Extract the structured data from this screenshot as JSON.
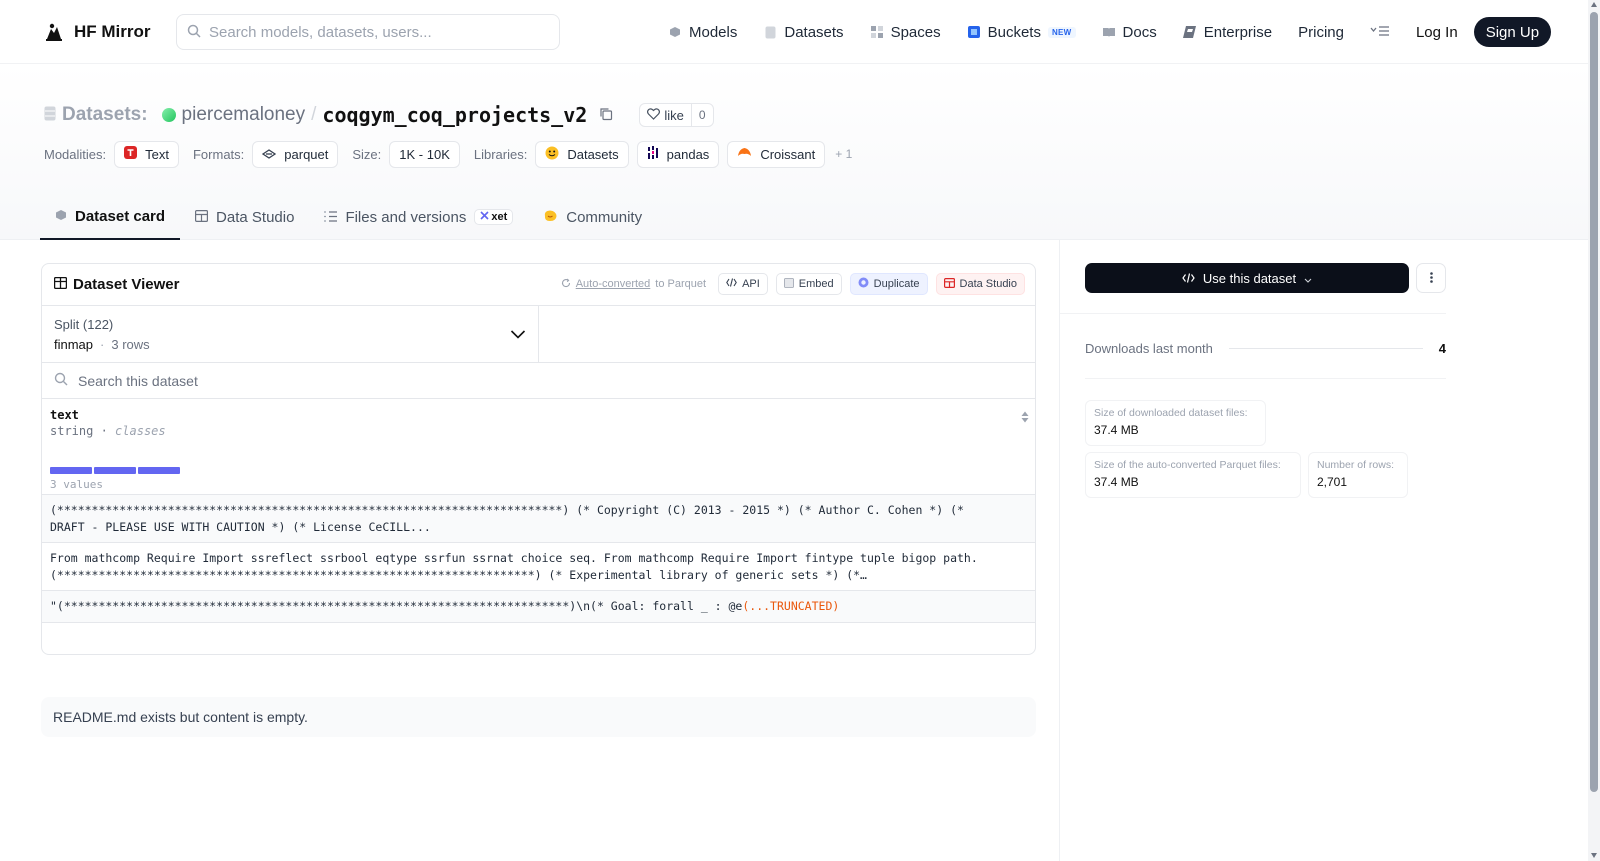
{
  "nav": {
    "brand": "HF Mirror",
    "search_placeholder": "Search models, datasets, users...",
    "links": [
      {
        "label": "Models",
        "icon": "model-cube-icon"
      },
      {
        "label": "Datasets",
        "icon": "database-icon"
      },
      {
        "label": "Spaces",
        "icon": "spaces-grid-icon"
      },
      {
        "label": "Buckets",
        "icon": "bucket-icon",
        "badge": "NEW"
      },
      {
        "label": "Docs",
        "icon": "book-icon"
      },
      {
        "label": "Enterprise",
        "icon": "enterprise-icon"
      },
      {
        "label": "Pricing"
      }
    ],
    "login": "Log In",
    "signup": "Sign Up"
  },
  "header": {
    "prefix": "Datasets:",
    "owner": "piercemaloney",
    "separator": "/",
    "repo": "coqgym_coq_projects_v2",
    "like_label": "like",
    "like_count": "0",
    "meta": {
      "modalities_label": "Modalities:",
      "modality": "Text",
      "formats_label": "Formats:",
      "format": "parquet",
      "size_label": "Size:",
      "size": "1K - 10K",
      "libraries_label": "Libraries:",
      "libraries": [
        "Datasets",
        "pandas",
        "Croissant"
      ],
      "more": "+ 1"
    }
  },
  "tabs": [
    {
      "label": "Dataset card",
      "active": true
    },
    {
      "label": "Data Studio"
    },
    {
      "label": "Files and versions",
      "badge": "xet"
    },
    {
      "label": "Community"
    }
  ],
  "viewer": {
    "title": "Dataset Viewer",
    "auto_converted": "Auto-converted",
    "to_parquet": "to Parquet",
    "actions": [
      "API",
      "Embed",
      "Duplicate",
      "Data Studio"
    ],
    "split_label": "Split (122)",
    "split_value": "finmap",
    "split_rows": "3 rows",
    "search_placeholder": "Search this dataset",
    "column": {
      "name": "text",
      "type": "string",
      "type_kind": "classes",
      "values_count": "3 values"
    },
    "rows": [
      {
        "line1": "(*************************************************************************) (* Copyright (C) 2013 - 2015 *) (* Author C. Cohen *) (*",
        "line2": "DRAFT - PLEASE USE WITH CAUTION *) (* License CeCILL..."
      },
      {
        "line1": "From mathcomp Require Import ssreflect ssrbool eqtype ssrfun ssrnat choice seq. From mathcomp Require Import fintype tuple bigop path.",
        "line2": "(*********************************************************************) (* Experimental library of generic sets *) (*…"
      },
      {
        "line1": "\"(*************************************************************************)\\n(* Goal: forall _ : @e",
        "truncated": "(...TRUNCATED)"
      }
    ]
  },
  "readme": "README.md exists but content is empty.",
  "sidebar": {
    "use_button": "Use this dataset",
    "downloads_label": "Downloads last month",
    "downloads_value": "4",
    "stats": [
      {
        "label": "Size of downloaded dataset files:",
        "value": "37.4 MB"
      },
      {
        "label": "Size of the auto-converted Parquet files:",
        "value": "37.4 MB"
      },
      {
        "label": "Number of rows:",
        "value": "2,701"
      }
    ]
  },
  "colors": {
    "accent_indigo": "#6366f1",
    "dark_button": "#0b0f19",
    "truncated_orange": "#ea580c"
  }
}
